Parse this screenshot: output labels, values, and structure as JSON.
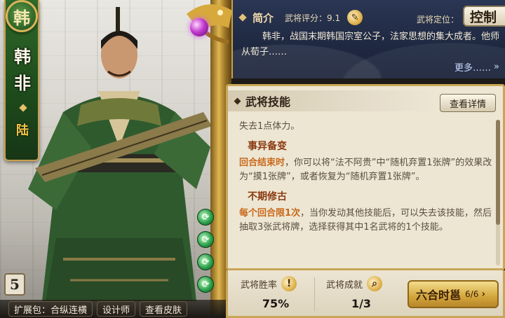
{
  "hero": {
    "kingdom": "韩",
    "name_chars": [
      "韩",
      "非"
    ],
    "tag": "陆",
    "level": "5"
  },
  "bottom_bar": {
    "expansion": "扩展包：合纵连横",
    "designer": "设计师",
    "skins": "查看皮肤"
  },
  "intro": {
    "title": "简介",
    "rating": "武将评分：9.1",
    "role_label": "武将定位：",
    "role": "控制",
    "text": "韩非，战国末期韩国宗室公子，法家思想的集大成者。他师从荀子……",
    "more": "更多……"
  },
  "skills": {
    "title": "武将技能",
    "detail_button": "查看详情",
    "intro_line": "失去1点体力。",
    "skill1": {
      "name": "事异备变",
      "highlight": "回合结束时",
      "text": "，你可以将“法不阿贵”中“随机弃置1张牌”的效果改为“摸1张牌”，或者恢复为“随机弃置1张牌”。"
    },
    "skill2": {
      "name": "不期修古",
      "highlight": "每个回合限1次",
      "text": "，当你发动其他技能后，可以失去该技能，然后抽取3张武将牌，选择获得其中1名武将的1个技能。"
    }
  },
  "stats": {
    "win_rate_label": "武将胜率",
    "win_rate": "75%",
    "achievement_label": "武将成就",
    "achievement": "1/3",
    "combo_label": "六合时邕",
    "combo_count": "6/6"
  },
  "colors": {
    "kingdom_green": "#2c6325",
    "gold_trim": "#c9a657",
    "highlight_orange": "#c9681a",
    "skill_name": "#8a3a10",
    "intro_bg": "#1e2840",
    "panel_bg": "#ede6d3"
  },
  "icons": {
    "rating": "notebook-icon",
    "win_rate": "exclamation-icon",
    "achievement": "magnifier-icon",
    "more": "double-chevron-right-icon",
    "skill_orb": "green-swirl-icon"
  }
}
